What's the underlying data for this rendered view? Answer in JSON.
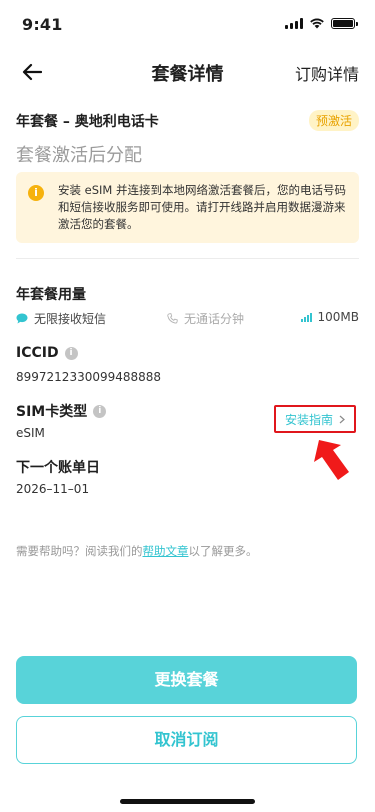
{
  "status_bar": {
    "time": "9:41"
  },
  "nav": {
    "title": "套餐详情",
    "right_link": "订购详情"
  },
  "plan": {
    "name": "年套餐 – 奥地利电话卡",
    "badge": "预激活",
    "subtitle": "套餐激活后分配"
  },
  "notice": {
    "text": "安装 eSIM 并连接到本地网络激活套餐后，您的电话号码和短信接收服务即可使用。请打开线路并启用数据漫游来激活您的套餐。"
  },
  "usage": {
    "title": "年套餐用量",
    "sms": "无限接收短信",
    "calls": "无通话分钟",
    "data": "100MB"
  },
  "iccid": {
    "label": "ICCID",
    "value": "8997212330099488888"
  },
  "sim_type": {
    "label": "SIM卡类型",
    "value": "eSIM",
    "install_guide": "安装指南"
  },
  "billing": {
    "label": "下一个账单日",
    "value": "2026–11–01"
  },
  "help": {
    "prefix": "需要帮助吗？阅读我们的",
    "link": "帮助文章",
    "suffix": "以了解更多。"
  },
  "buttons": {
    "change_plan": "更换套餐",
    "cancel_subscription": "取消订阅"
  },
  "colors": {
    "accent": "#58d3d9",
    "accent_text": "#33c4d0",
    "highlight_border": "#e0161c",
    "badge_bg": "#fff3c6",
    "badge_text": "#e8a200",
    "notice_bg": "#fff5dd"
  }
}
